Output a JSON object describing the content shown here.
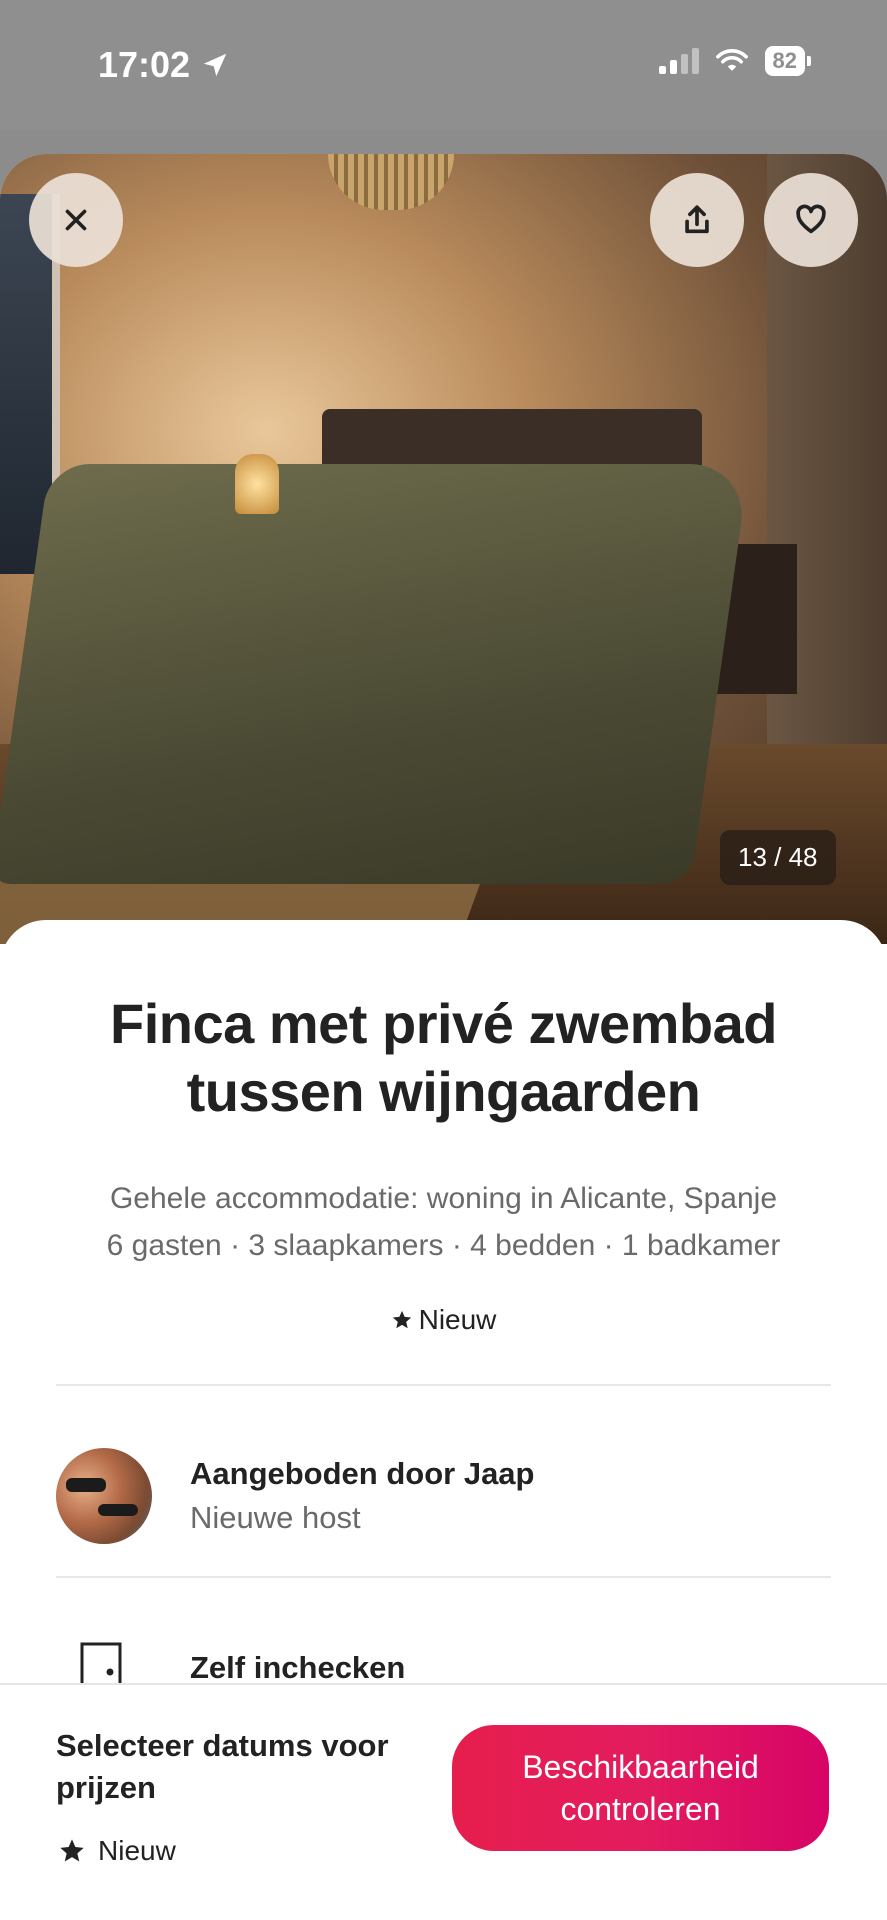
{
  "status_bar": {
    "time": "17:02",
    "battery": "82",
    "location_icon": "location-arrow-icon",
    "wifi_icon": "wifi-icon",
    "signal_icon": "cellular-signal-icon"
  },
  "photo": {
    "counter": "13 / 48",
    "close_icon": "close-icon",
    "share_icon": "share-icon",
    "heart_icon": "heart-icon"
  },
  "listing": {
    "title": "Finca met privé zwembad tussen wijngaarden",
    "subtitle_line1": "Gehele accommodatie: woning in Alicante, Spanje",
    "subtitle_line2": "6 gasten · 3 slaapkamers · 4 bedden · 1 badkamer",
    "rating_label": "Nieuw"
  },
  "host": {
    "name_label": "Aangeboden door Jaap",
    "status": "Nieuwe host"
  },
  "highlights": [
    {
      "icon": "door-icon",
      "label": "Zelf inchecken"
    }
  ],
  "footer": {
    "price_label": "Selecteer datums voor prijzen",
    "rating_label": "Nieuw",
    "cta_label": "Beschikbaarheid controleren"
  },
  "colors": {
    "accent": "#E31C5F",
    "text_primary": "#222222",
    "text_secondary": "#6A6A6A"
  }
}
